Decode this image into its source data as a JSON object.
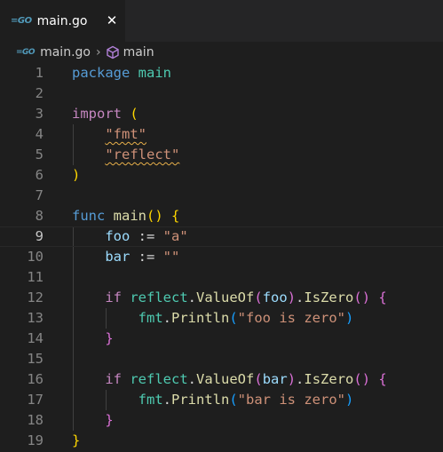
{
  "tab": {
    "icon": "go-file-icon",
    "label": "main.go",
    "close_glyph": "✕"
  },
  "breadcrumb": {
    "file_icon": "go-file-icon",
    "file": "main.go",
    "separator": "›",
    "symbol_icon": "symbol-method-icon",
    "symbol": "main"
  },
  "editor": {
    "current_line": 9,
    "line_numbers": [
      "1",
      "2",
      "3",
      "4",
      "5",
      "6",
      "7",
      "8",
      "9",
      "10",
      "11",
      "12",
      "13",
      "14",
      "15",
      "16",
      "17",
      "18",
      "19"
    ],
    "lines": [
      "package main",
      "",
      "import (",
      "    \"fmt\"",
      "    \"reflect\"",
      ")",
      "",
      "func main() {",
      "    foo := \"a\"",
      "    bar := \"\"",
      "",
      "    if reflect.ValueOf(foo).IsZero() {",
      "        fmt.Println(\"foo is zero\")",
      "    }",
      "",
      "    if reflect.ValueOf(bar).IsZero() {",
      "        fmt.Println(\"bar is zero\")",
      "    }",
      "}"
    ],
    "colors": {
      "keyword": "#569cd6",
      "control": "#c586c0",
      "function": "#dcdcaa",
      "variable": "#9cdcfe",
      "package": "#4ec9b0",
      "string": "#ce9178",
      "bracket_1": "#ffd700",
      "bracket_2": "#da70d6",
      "bracket_3": "#179fff",
      "warning_squiggle": "#e8b04a"
    }
  }
}
